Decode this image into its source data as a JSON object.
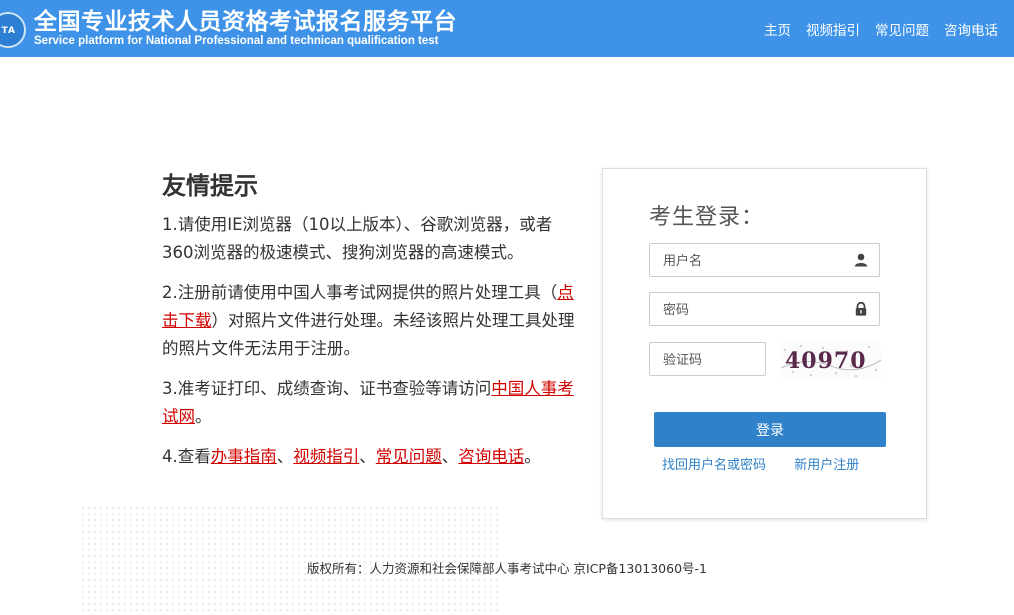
{
  "header": {
    "logo_text": "CTA",
    "title": "全国专业技术人员资格考试报名服务平台",
    "subtitle": "Service platform for National Professional and technican qualification test",
    "nav": [
      "主页",
      "视频指引",
      "常见问题",
      "咨询电话"
    ]
  },
  "tips": {
    "heading": "友情提示",
    "item1": "1.请使用IE浏览器（10以上版本）、谷歌浏览器，或者360浏览器的极速模式、搜狗浏览器的高速模式。",
    "item2_before": "2.注册前请使用中国人事考试网提供的照片处理工具（",
    "item2_link": "点击下载",
    "item2_after": "）对照片文件进行处理。未经该照片处理工具处理的照片文件无法用于注册。",
    "item3_before": "3.准考证打印、成绩查询、证书查验等请访问",
    "item3_link": "中国人事考试网",
    "item3_after": "。",
    "item4_before": "4.查看",
    "item4_links": [
      "办事指南",
      "视频指引",
      "常见问题",
      "咨询电话"
    ],
    "item4_sep": "、",
    "item4_after": "。"
  },
  "login": {
    "title": "考生登录：",
    "username_placeholder": "用户名",
    "password_placeholder": "密码",
    "captcha_placeholder": "验证码",
    "captcha_text": "40970",
    "login_label": "登录",
    "recover_label": "找回用户名或密码",
    "register_label": "新用户注册"
  },
  "footer": {
    "copyright": "版权所有：人力资源和社会保障部人事考试中心 京ICP备13013060号-1"
  },
  "colors": {
    "header_bg": "#3e93e8",
    "button_bg": "#2f82c9",
    "link_red": "#d20000",
    "link_blue": "#2f82c9"
  },
  "icons": [
    "user-icon",
    "lock-icon"
  ]
}
